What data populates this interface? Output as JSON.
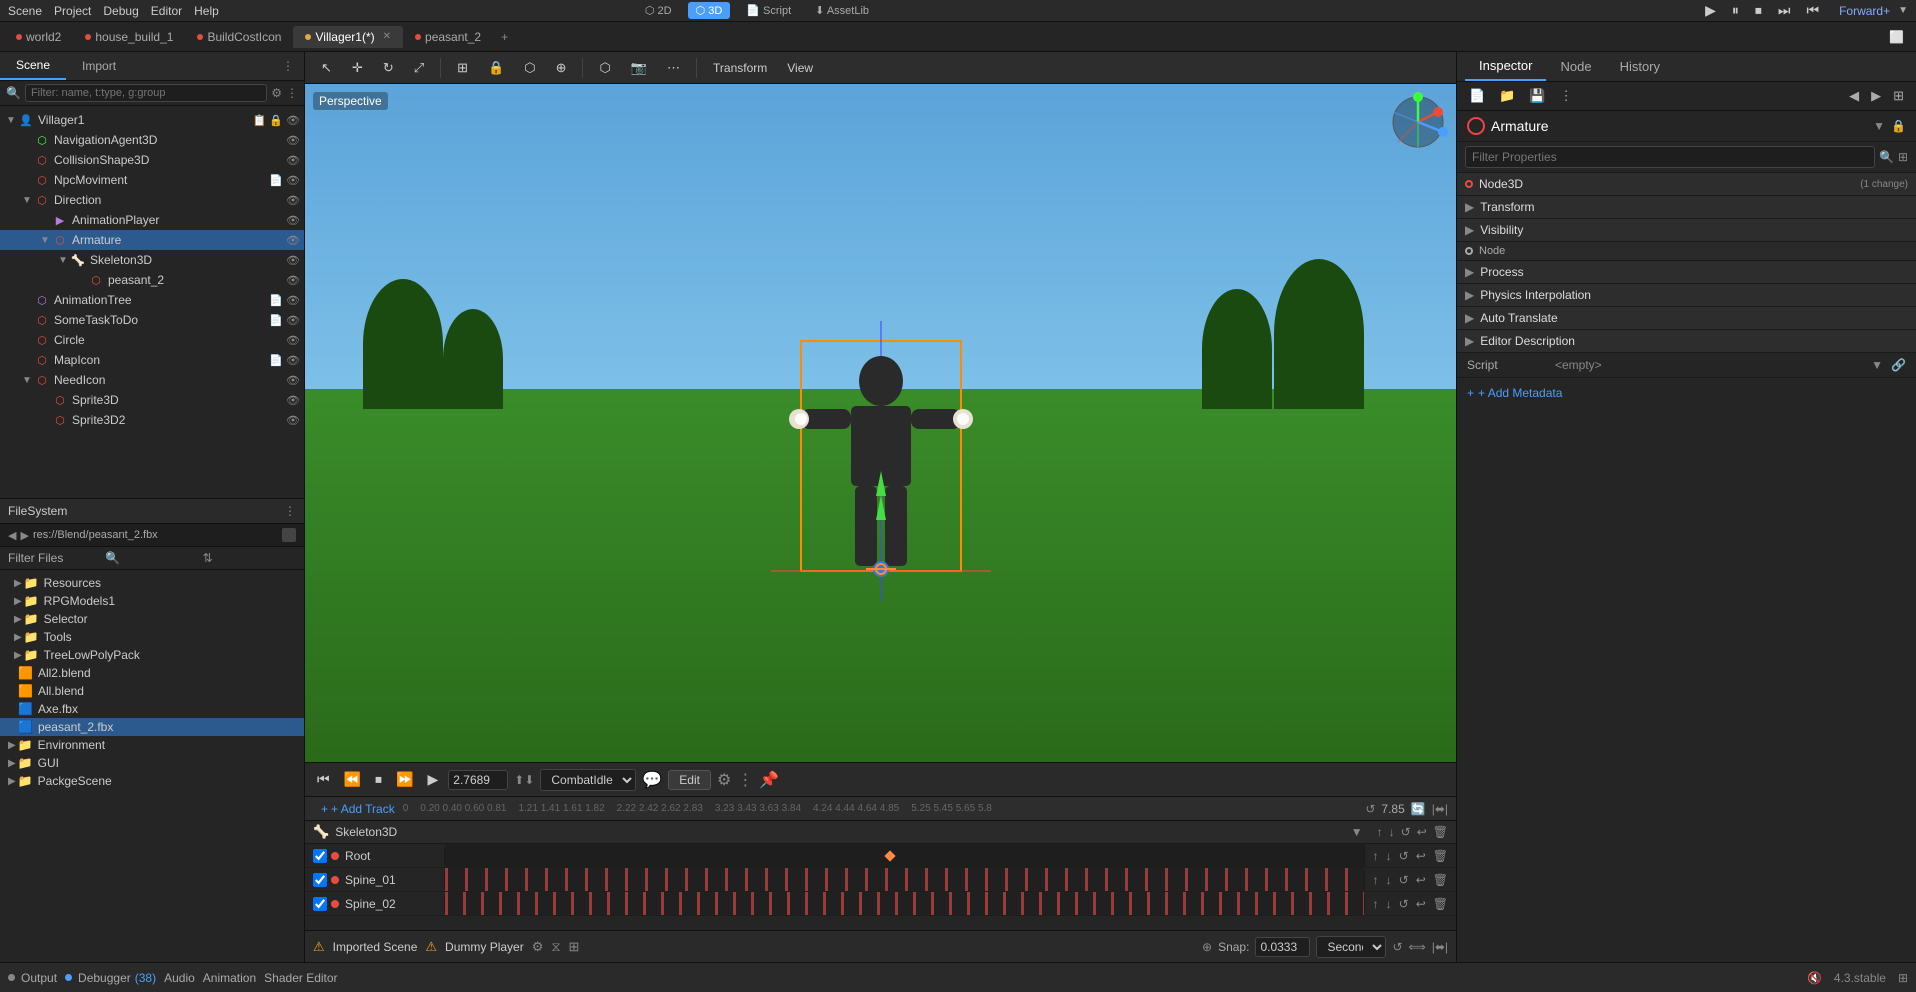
{
  "topMenu": {
    "items": [
      "Scene",
      "Project",
      "Debug",
      "Editor",
      "Help"
    ],
    "modes": [
      "2D",
      "3D",
      "Script",
      "AssetLib"
    ],
    "activeMode": "3D",
    "playButtons": [
      "▶",
      "⏸",
      "⏹",
      "⏭",
      "⏮"
    ],
    "rightLabel": "Forward+"
  },
  "tabs": {
    "items": [
      {
        "label": "world2",
        "dot": "#e74c3c",
        "active": false,
        "closeable": false
      },
      {
        "label": "house_build_1",
        "dot": "#e74c3c",
        "active": false,
        "closeable": false
      },
      {
        "label": "BuildCostIcon",
        "dot": "#e74c3c",
        "active": false,
        "closeable": false
      },
      {
        "label": "Villager1(*)",
        "dot": "#e7a93c",
        "active": true,
        "closeable": true
      },
      {
        "label": "peasant_2",
        "dot": "#e74c3c",
        "active": false,
        "closeable": false
      }
    ]
  },
  "toolbar": {
    "transform_label": "Transform",
    "view_label": "View"
  },
  "viewport": {
    "label": "Perspective"
  },
  "scenePanel": {
    "tabs": [
      "Scene",
      "Import"
    ],
    "activeTab": "Scene",
    "rootNode": "Villager1",
    "nodes": [
      {
        "label": "NavigationAgent3D",
        "indent": 1,
        "type": "nav"
      },
      {
        "label": "CollisionShape3D",
        "indent": 1,
        "type": "collision"
      },
      {
        "label": "NpcMoviment",
        "indent": 1,
        "type": "script"
      },
      {
        "label": "Direction",
        "indent": 1,
        "type": "group",
        "expanded": true
      },
      {
        "label": "AnimationPlayer",
        "indent": 2,
        "type": "anim"
      },
      {
        "label": "Armature",
        "indent": 2,
        "type": "armature",
        "selected": true
      },
      {
        "label": "Skeleton3D",
        "indent": 3,
        "type": "skeleton"
      },
      {
        "label": "peasant_2",
        "indent": 4,
        "type": "mesh"
      },
      {
        "label": "AnimationTree",
        "indent": 1,
        "type": "animtree"
      },
      {
        "label": "SomeTaskToDo",
        "indent": 1,
        "type": "script"
      },
      {
        "label": "Circle",
        "indent": 1,
        "type": "circle"
      },
      {
        "label": "MapIcon",
        "indent": 1,
        "type": "icon"
      },
      {
        "label": "NeedIcon",
        "indent": 1,
        "type": "icon",
        "expanded": true
      },
      {
        "label": "Sprite3D",
        "indent": 2,
        "type": "sprite"
      },
      {
        "label": "Sprite3D2",
        "indent": 2,
        "type": "sprite"
      }
    ]
  },
  "filesystem": {
    "title": "FileSystem",
    "path": "res://Blend/peasant_2.fbx",
    "filterLabel": "Filter Files",
    "folders": [
      {
        "label": "Resources",
        "indent": 1,
        "type": "folder"
      },
      {
        "label": "RPGModels1",
        "indent": 1,
        "type": "folder"
      },
      {
        "label": "Selector",
        "indent": 1,
        "type": "folder"
      },
      {
        "label": "Tools",
        "indent": 1,
        "type": "folder"
      },
      {
        "label": "TreeLowPolyPack",
        "indent": 1,
        "type": "folder"
      },
      {
        "label": "All2.blend",
        "indent": 1,
        "type": "blend"
      },
      {
        "label": "All.blend",
        "indent": 1,
        "type": "blend"
      },
      {
        "label": "Axe.fbx",
        "indent": 1,
        "type": "fbx"
      },
      {
        "label": "peasant_2.fbx",
        "indent": 1,
        "type": "fbx",
        "selected": true
      },
      {
        "label": "Environment",
        "indent": 0,
        "type": "folder"
      },
      {
        "label": "GUI",
        "indent": 0,
        "type": "folder"
      },
      {
        "label": "PackgeScene",
        "indent": 0,
        "type": "folder"
      }
    ]
  },
  "animation": {
    "timeValue": "2.7689",
    "animName": "CombatIdle",
    "totalTime": "7.85",
    "snapLabel": "Snap:",
    "snapValue": "0.0333",
    "snapUnit": "Seconds",
    "addTrackLabel": "+ Add Track",
    "editLabel": "Edit",
    "rulerTimes": [
      "0",
      "0.20.40.60.81",
      "1.21.41.61.82",
      "2.22.42.62.83",
      "3.23.43.63.84",
      "4.24.44.64.85",
      "5.25.45.65.8"
    ],
    "skeleton3DLabel": "Skeleton3D",
    "tracks": [
      {
        "name": "Root",
        "checked": true
      },
      {
        "name": "Spine_01",
        "checked": true
      },
      {
        "name": "Spine_02",
        "checked": true
      }
    ],
    "bottomTags": [
      {
        "label": "Imported Scene",
        "dot": "#f0a020"
      },
      {
        "label": "Dummy Player",
        "dot": "#f0a020"
      }
    ]
  },
  "inspector": {
    "tabs": [
      "Inspector",
      "Node",
      "History"
    ],
    "activeTab": "Inspector",
    "nodeName": "Armature",
    "filterPlaceholder": "Filter Properties",
    "nodeTypeSeparator": "Node3D",
    "nodeTypeBadge": "(1 change)",
    "sections": [
      {
        "label": "Transform",
        "arrow": "▶"
      },
      {
        "label": "Visibility",
        "arrow": "▶"
      }
    ],
    "nodeSeparator": "Node",
    "subsections": [
      {
        "label": "Process"
      },
      {
        "label": "Physics Interpolation"
      },
      {
        "label": "Auto Translate"
      },
      {
        "label": "Editor Description"
      }
    ],
    "scriptLabel": "Script",
    "scriptValue": "<empty>",
    "addMetaLabel": "+ Add Metadata"
  },
  "statusBar": {
    "output": "Output",
    "debugger": "Debugger",
    "debuggerCount": "(38)",
    "audio": "Audio",
    "animation": "Animation",
    "shaderEditor": "Shader Editor",
    "version": "4.3.stable"
  }
}
